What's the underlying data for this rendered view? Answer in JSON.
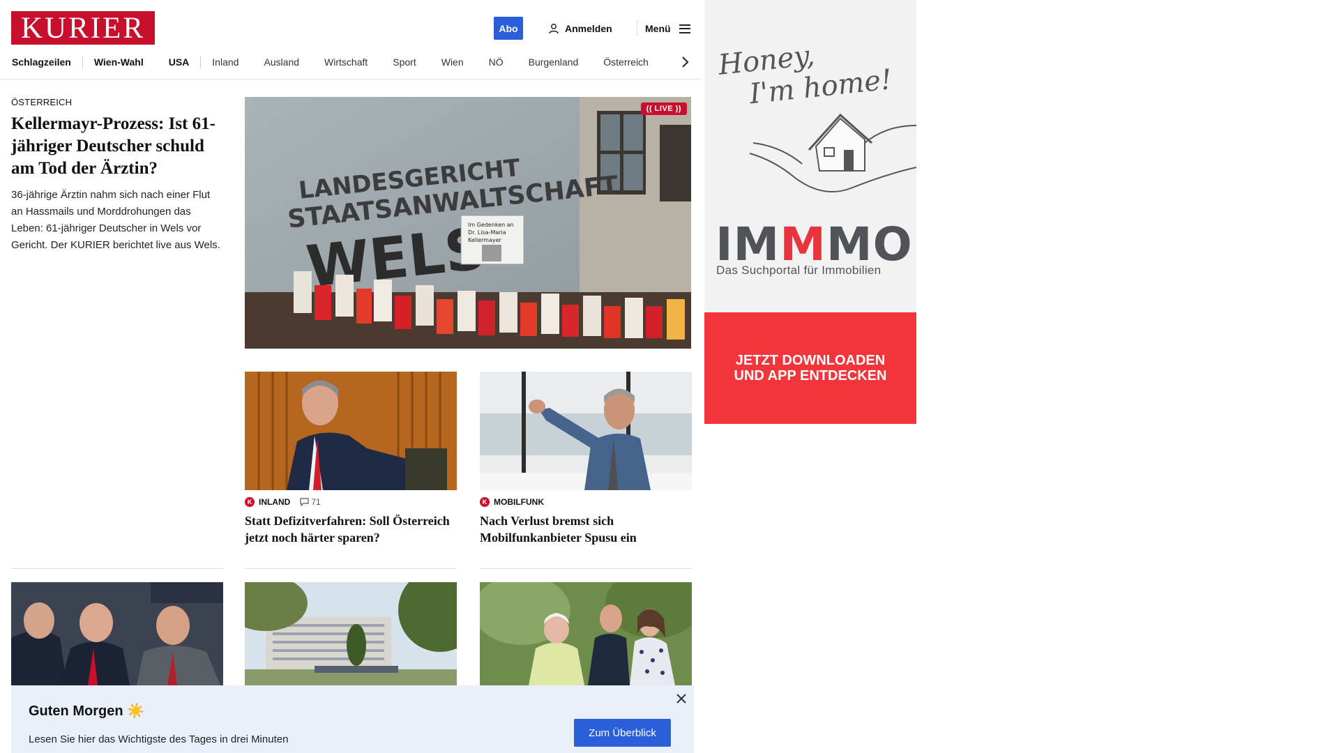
{
  "header": {
    "logo": "KURIER",
    "abo_label": "Abo",
    "login_label": "Anmelden",
    "menu_label": "Menü",
    "nav": [
      "Schlagzeilen",
      "Wien-Wahl",
      "USA",
      "Inland",
      "Ausland",
      "Wirtschaft",
      "Sport",
      "Wien",
      "NÖ",
      "Burgenland",
      "Österreich"
    ]
  },
  "lead": {
    "kicker": "Österreich",
    "title": "Kellermayr-Prozess: Ist 61-jähriger Deutscher schuld am Tod der Ärztin?",
    "subtitle": "36-jährige Ärztin nahm sich nach einer Flut an Hassmails und Morddrohungen das Leben: 61-jähriger Deutscher in Wels vor Gericht. Der KURIER berichtet live aus Wels.",
    "live_badge": "(( LIVE ))",
    "image_text": {
      "line1": "LANDESGERICHT",
      "line2": "STAATSANWALTSCHAFT",
      "line3": "WELS",
      "memorial_line1": "Im Gedenken an",
      "memorial_line2": "Dr. Lisa-Maria",
      "memorial_line3": "Kellermayer"
    }
  },
  "cards": [
    {
      "category": "Inland",
      "k_icon": "K",
      "comments": "71",
      "title": "Statt Defizitverfahren: Soll Österreich jetzt noch härter sparen?"
    },
    {
      "category": "Mobilfunk",
      "k_icon": "K",
      "title": "Nach Verlust bremst sich Mobilfunkanbieter Spusu ein"
    }
  ],
  "ad": {
    "script_line1": "Honey,",
    "script_line2": "I'm home!",
    "brand_start": "IM",
    "brand_red": "M",
    "brand_end": "MO",
    "tagline": "Das Suchportal für Immobilien",
    "cta_line1": "JETZT DOWNLOADEN",
    "cta_line2": "UND APP ENTDECKEN"
  },
  "banner": {
    "title": "Guten Morgen ☀️",
    "subtitle": "Lesen Sie hier das Wichtigste des Tages in drei Minuten",
    "button_label": "Zum Überblick"
  },
  "colors": {
    "brand_red": "#c8102e",
    "accent_blue": "#2b5fd9",
    "ad_red": "#f2353b",
    "banner_bg": "#eaf0f9"
  }
}
